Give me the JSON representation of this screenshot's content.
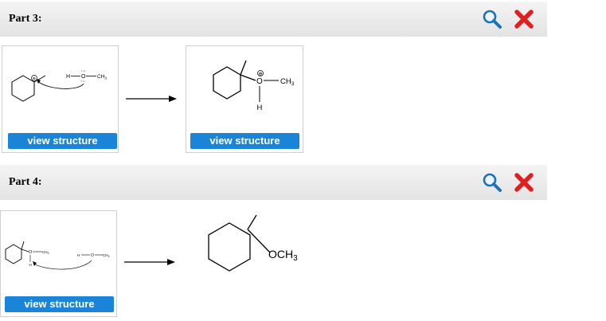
{
  "parts": [
    {
      "title": "Part 3:",
      "reactant": {
        "labels": {
          "h": "H",
          "o": "O",
          "ch3": "CH",
          "sub": "3",
          "plus": "⊕"
        },
        "button_label": "view structure"
      },
      "product": {
        "labels": {
          "plus": "⊕",
          "o": "O",
          "ch3": "CH",
          "sub": "3",
          "h": "H"
        },
        "button_label": "view structure"
      }
    },
    {
      "title": "Part 4:",
      "reactant": {
        "labels": {
          "o": "O",
          "ch3": "CH",
          "sub": "3",
          "h": "H",
          "o2": "O",
          "h2": "H",
          "ch3b": "CH",
          "sub2": "3"
        },
        "button_label": "view structure"
      },
      "product": {
        "labels": {
          "och3": "OCH",
          "sub": "3"
        }
      }
    }
  ],
  "icons": {
    "search": "magnifier-icon",
    "wrong": "red-x-icon"
  },
  "colors": {
    "button": "#1a85d8",
    "wrong": "#e02020",
    "search": "#1b72b8"
  }
}
